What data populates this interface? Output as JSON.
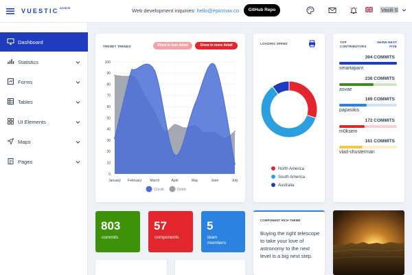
{
  "header": {
    "brand": "VUESTIC",
    "brand_sub": "ADMIN",
    "inquiry_text": "Web development inquiries: ",
    "inquiry_email": "hello@epicmax.co",
    "github_label": "GitHub Repo",
    "user_name": "Vasili S",
    "icons": [
      "menu-icon",
      "palette-icon",
      "mail-icon",
      "bell-icon",
      "flag-uk-icon",
      "chevron-down-icon"
    ]
  },
  "sidebar": {
    "items": [
      {
        "label": "Dashboard",
        "icon": "monitor-icon",
        "active": true
      },
      {
        "label": "Statistics",
        "icon": "bar-chart-icon"
      },
      {
        "label": "Forms",
        "icon": "form-icon"
      },
      {
        "label": "Tables",
        "icon": "table-icon"
      },
      {
        "label": "UI Elements",
        "icon": "grid-icon"
      },
      {
        "label": "Maps",
        "icon": "send-icon"
      },
      {
        "label": "Pages",
        "icon": "pages-icon"
      }
    ]
  },
  "trend_card": {
    "title": "TRENDY TRENDS",
    "btn_less": "Show in less detail",
    "btn_more": "Show in more detail",
    "legend": [
      "Credit",
      "Debit"
    ]
  },
  "loading_card": {
    "title": "LOADING SPEED",
    "legend": [
      "North America",
      "South America",
      "Australia"
    ]
  },
  "contributors": {
    "title_line1": "TOP",
    "title_line2": "CONTRIBUTORS",
    "next_line1": "SHOW NEXT",
    "next_line2": "FIVE",
    "list": [
      {
        "name": "smartapant",
        "commits": "394 COMMITS",
        "ratio": 1.0,
        "color": "#1f3cbf",
        "track": "#cdd6f6"
      },
      {
        "name": "asvae",
        "commits": "236 COMMITS",
        "ratio": 0.6,
        "color": "#3d8d1e",
        "track": "#cfe5c5"
      },
      {
        "name": "papasikis",
        "commits": "189 COMMITS",
        "ratio": 0.48,
        "color": "#2c82e0",
        "track": "#cfe2f8"
      },
      {
        "name": "m0ksem",
        "commits": "172 COMMITS",
        "ratio": 0.44,
        "color": "#e3262e",
        "track": "#f8d0d2"
      },
      {
        "name": "vlad-shusterman",
        "commits": "161 COMMITS",
        "ratio": 0.41,
        "color": "#f0cc3b",
        "track": "#fbefc4"
      }
    ]
  },
  "stats": [
    {
      "value": "803",
      "label": "commits",
      "color": "#3d9209"
    },
    {
      "value": "57",
      "label": "components",
      "color": "#e3262e"
    },
    {
      "value": "5",
      "label": "team members",
      "color": "#2c82e0"
    }
  ],
  "rich_card": {
    "title": "COMPONENT RICH THEME",
    "text": "Buying the right telescope to take your love of astronomy to the next level is a big next step."
  },
  "chart_data": [
    {
      "type": "area",
      "title": "TRENDY TRENDS",
      "categories": [
        "January",
        "February",
        "March",
        "April",
        "May",
        "June",
        "July"
      ],
      "ylim": [
        0,
        100
      ],
      "y_ticks": [
        "0",
        "10",
        "20",
        "30",
        "40",
        "50",
        "60",
        "70",
        "80",
        "90",
        "100"
      ],
      "series": [
        {
          "name": "Credit",
          "color": "#4a6ed6",
          "points": [
            [
              0,
              32
            ],
            [
              0.75,
              87
            ],
            [
              1,
              93
            ],
            [
              2,
              92
            ],
            [
              3,
              17
            ],
            [
              4,
              62
            ],
            [
              5,
              97
            ],
            [
              6,
              9
            ]
          ]
        },
        {
          "name": "Debit",
          "color": "#9aa0a8",
          "points": [
            [
              0,
              88
            ],
            [
              0.5,
              87
            ],
            [
              1,
              86
            ],
            [
              1.5,
              70
            ],
            [
              2,
              55
            ],
            [
              2.5,
              38
            ],
            [
              3,
              44
            ],
            [
              3.5,
              41
            ],
            [
              4,
              43
            ],
            [
              4.5,
              37
            ],
            [
              5,
              37
            ],
            [
              5.5,
              32
            ],
            [
              6,
              38
            ]
          ]
        }
      ],
      "grid": true,
      "legend_position": "bottom"
    },
    {
      "type": "pie",
      "title": "LOADING SPEED",
      "donut": true,
      "labels": [
        "North America",
        "South America",
        "Australia"
      ],
      "values": [
        30,
        60,
        10
      ],
      "colors": [
        "#e3262e",
        "#2c9fe0",
        "#1f3cbf"
      ],
      "legend_position": "bottom"
    }
  ]
}
